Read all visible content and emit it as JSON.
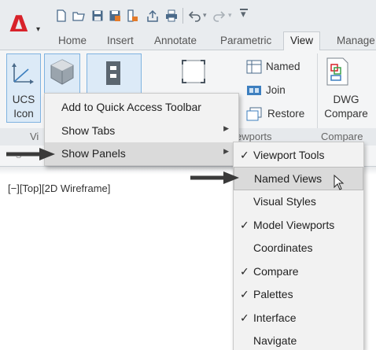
{
  "app": {
    "logo_letter": "A",
    "logo_color": "#d8222a"
  },
  "quick_access": {
    "icons": [
      "new-icon",
      "open-icon",
      "save-icon",
      "save-as-icon",
      "import-icon",
      "export-icon",
      "print-icon",
      "undo-icon",
      "redo-icon",
      "customize-icon"
    ]
  },
  "ribbon_tabs": [
    {
      "label": "Home"
    },
    {
      "label": "Insert"
    },
    {
      "label": "Annotate"
    },
    {
      "label": "Parametric"
    },
    {
      "label": "View",
      "active": true
    },
    {
      "label": "Manage"
    }
  ],
  "ribbon": {
    "ucs_label_1": "UCS",
    "ucs_label_2": "Icon",
    "panel_title_partial_1": "Vi",
    "panel_title_partial_2": "S",
    "named_label": "Named",
    "join_label": "Join",
    "restore_label": "Restore",
    "viewports_title_partial": "ewports",
    "dwg_label_1": "DWG",
    "dwg_label_2": "Compare",
    "compare_title": "Compare"
  },
  "viewport": {
    "label": "[−][Top][2D Wireframe]"
  },
  "context_menu": {
    "items": [
      {
        "label": "Add to Quick Access Toolbar",
        "has_submenu": false
      },
      {
        "label": "Show Tabs",
        "has_submenu": true
      },
      {
        "label": "Show Panels",
        "has_submenu": true,
        "highlighted": true
      }
    ]
  },
  "show_panels_submenu": {
    "items": [
      {
        "label": "Viewport Tools",
        "checked": true,
        "check_mark": "✓"
      },
      {
        "label": "Named Views",
        "checked": false,
        "highlighted": true,
        "check_mark": ""
      },
      {
        "label": "Visual Styles",
        "checked": false,
        "check_mark": ""
      },
      {
        "label": "Model Viewports",
        "checked": true,
        "check_mark": "✓"
      },
      {
        "label": "Coordinates",
        "checked": false,
        "check_mark": ""
      },
      {
        "label": "Compare",
        "checked": true,
        "check_mark": "✓"
      },
      {
        "label": "Palettes",
        "checked": true,
        "check_mark": "✓"
      },
      {
        "label": "Interface",
        "checked": true,
        "check_mark": "✓"
      },
      {
        "label": "Navigate",
        "checked": false,
        "check_mark": ""
      }
    ]
  },
  "colors": {
    "accent_selection": "#7fb3e0",
    "menu_background": "#f2f2f2",
    "menu_highlight": "#dadada",
    "pointer_arrow": "#3a3a3a"
  }
}
